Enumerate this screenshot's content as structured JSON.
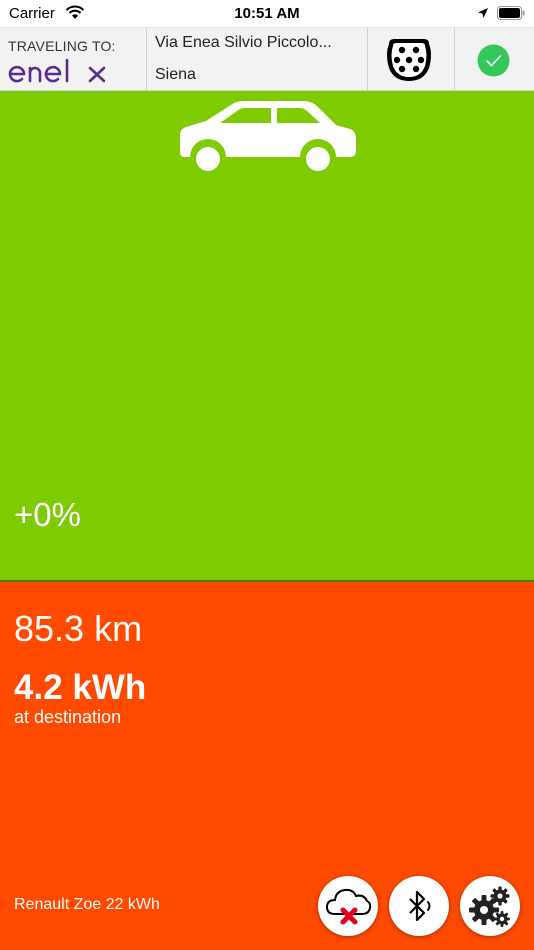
{
  "status_bar": {
    "carrier": "Carrier",
    "time": "10:51 AM",
    "icons": [
      "wifi-icon",
      "location-arrow-icon",
      "battery-icon"
    ]
  },
  "header": {
    "traveling_label": "TRAVELING TO:",
    "brand": "enel x",
    "destination_street": "Via Enea Silvio Piccolo...",
    "destination_city": "Siena",
    "connector_icon": "type2-plug-icon",
    "status_icon": "check-circle-icon"
  },
  "charge": {
    "percent_label": "+0%",
    "vehicle_icon": "car-icon"
  },
  "trip": {
    "range": "85.3 km",
    "energy": "4.2 kWh",
    "energy_caption": "at destination",
    "vehicle_name": "Renault Zoe 22 kWh"
  },
  "actions": [
    {
      "name": "cloud-offline-button",
      "icon": "cloud-x-icon"
    },
    {
      "name": "bluetooth-button",
      "icon": "bluetooth-icon"
    },
    {
      "name": "settings-button",
      "icon": "gears-icon"
    }
  ],
  "colors": {
    "charge_area": "#7dcb00",
    "energy_area": "#ff4a00",
    "check_green": "#34c759",
    "brand_purple": "#5b2c8f",
    "error_red": "#e3001b"
  }
}
